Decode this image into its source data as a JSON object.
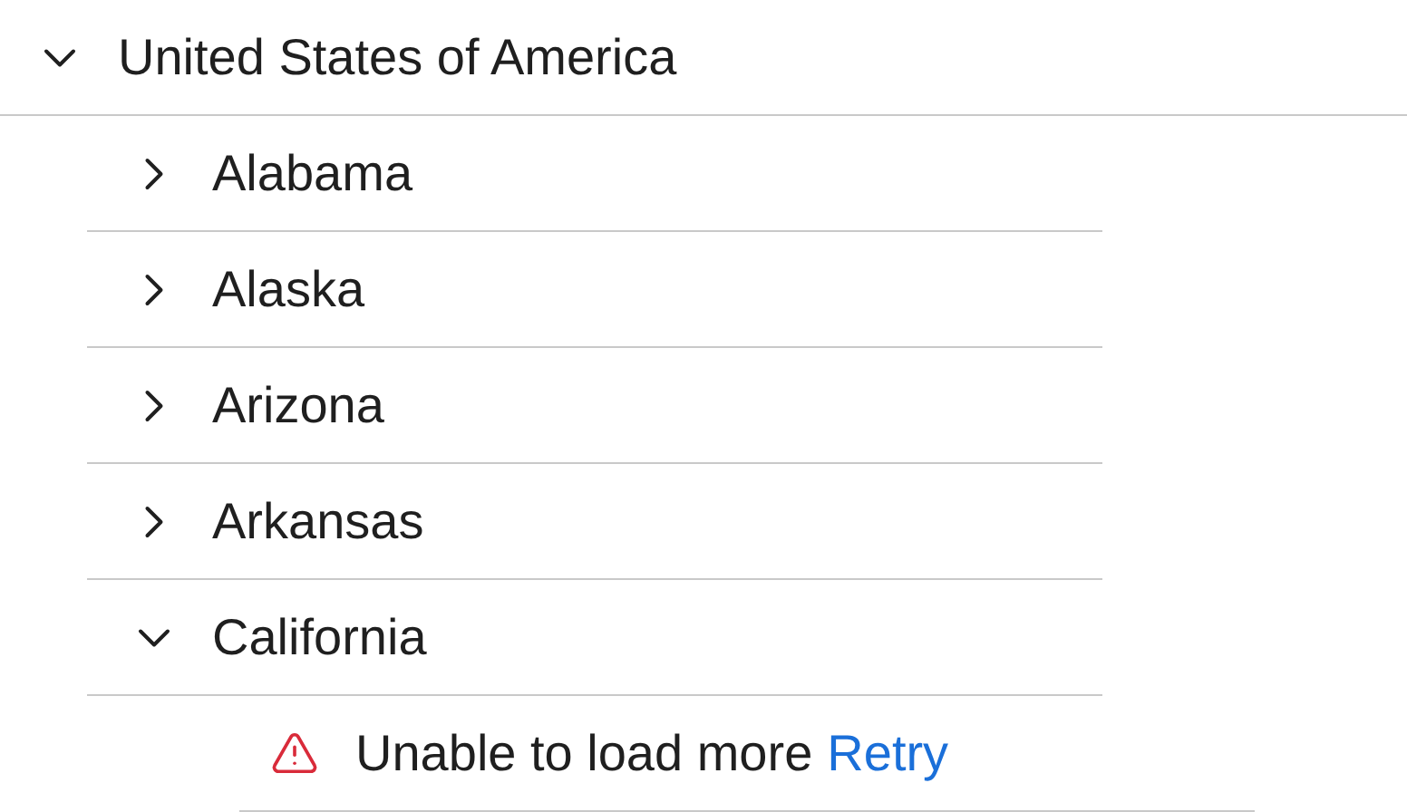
{
  "tree": [
    {
      "kind": "node",
      "label": "United States of America",
      "expanded": true,
      "children": [
        {
          "kind": "node",
          "label": "Alabama",
          "expanded": false
        },
        {
          "kind": "node",
          "label": "Alaska",
          "expanded": false
        },
        {
          "kind": "node",
          "label": "Arizona",
          "expanded": false
        },
        {
          "kind": "node",
          "label": "Arkansas",
          "expanded": false
        },
        {
          "kind": "node",
          "label": "California",
          "expanded": true,
          "children": [
            {
              "kind": "error",
              "message": "Unable to load more",
              "action": "Retry"
            }
          ]
        }
      ]
    }
  ]
}
